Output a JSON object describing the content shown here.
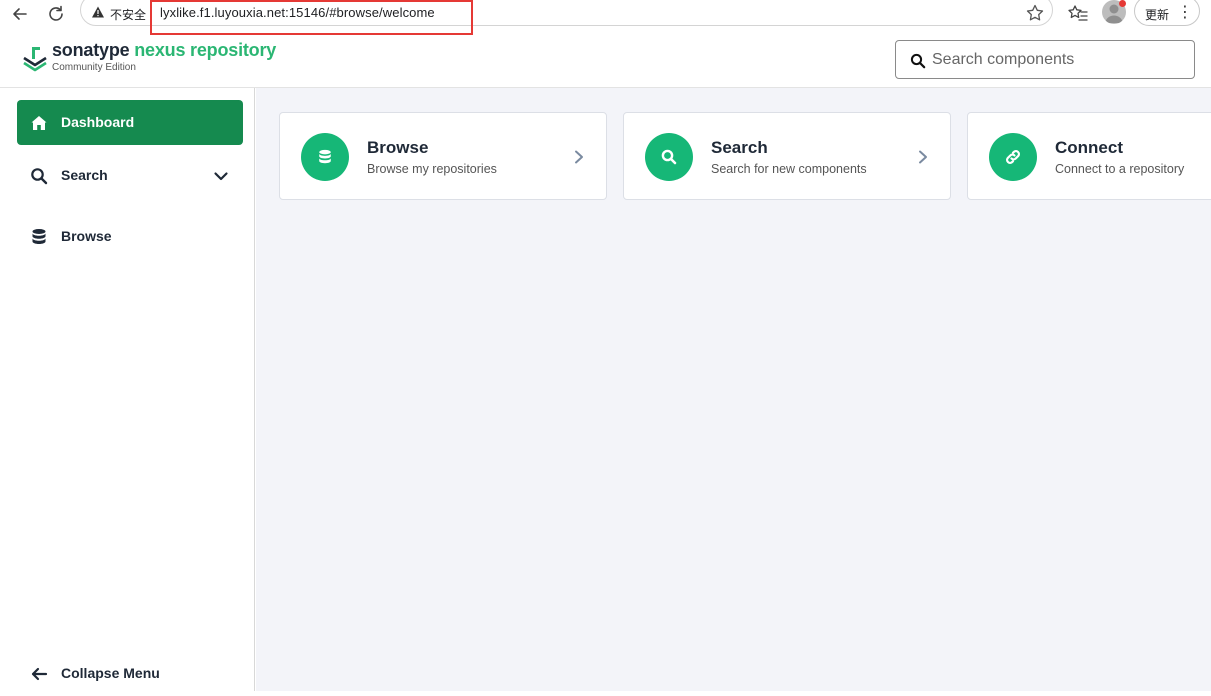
{
  "browser": {
    "security_label": "不安全",
    "url": "lyxlike.f1.luyouxia.net:15146/#browse/welcome",
    "update_label": "更新",
    "more_label": "⋮"
  },
  "header": {
    "brand_part1": "sonatype ",
    "brand_part2": "nexus repository",
    "edition": "Community Edition",
    "search_placeholder": "Search components"
  },
  "sidebar": {
    "items": [
      {
        "label": "Dashboard",
        "icon": "home-icon",
        "active": true
      },
      {
        "label": "Search",
        "icon": "search-icon",
        "expandable": true
      },
      {
        "label": "Browse",
        "icon": "database-icon"
      }
    ],
    "collapse_label": "Collapse Menu"
  },
  "cards": [
    {
      "title": "Browse",
      "subtitle": "Browse my repositories",
      "icon": "database-icon"
    },
    {
      "title": "Search",
      "subtitle": "Search for new components",
      "icon": "search-icon"
    },
    {
      "title": "Connect",
      "subtitle": "Connect to a repository",
      "icon": "link-icon"
    }
  ],
  "colors": {
    "accent_green": "#158a4f",
    "icon_green": "#16b777",
    "annotation_red": "#e53935"
  }
}
